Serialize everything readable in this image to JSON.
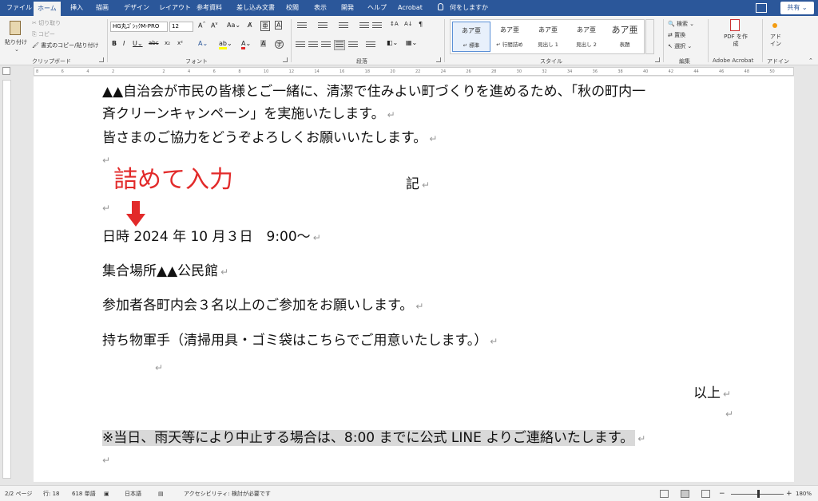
{
  "tabs": [
    {
      "label": "ファイル",
      "active": false
    },
    {
      "label": "ホーム",
      "active": true
    },
    {
      "label": "挿入",
      "active": false
    },
    {
      "label": "描画",
      "active": false
    },
    {
      "label": "デザイン",
      "active": false
    },
    {
      "label": "レイアウト",
      "active": false
    },
    {
      "label": "参考資料",
      "active": false
    },
    {
      "label": "差し込み文書",
      "active": false
    },
    {
      "label": "校閲",
      "active": false
    },
    {
      "label": "表示",
      "active": false
    },
    {
      "label": "開発",
      "active": false
    },
    {
      "label": "ヘルプ",
      "active": false
    },
    {
      "label": "Acrobat",
      "active": false
    }
  ],
  "tellme": "何をしますか",
  "share_label": "共有",
  "ribbon": {
    "clipboard": {
      "paste": "貼り付け",
      "cut": "切り取り",
      "copy": "コピー",
      "format_painter": "書式のコピー/貼り付け",
      "group": "クリップボード"
    },
    "font": {
      "family": "HG丸ｺﾞｼｯｸM-PRO",
      "size": "12",
      "group": "フォント"
    },
    "paragraph": {
      "group": "段落"
    },
    "styles": {
      "items": [
        {
          "preview": "あア亜",
          "name": "↵ 標準",
          "active": true
        },
        {
          "preview": "あア亜",
          "name": "↵ 行間詰め",
          "active": false
        },
        {
          "preview": "あア亜",
          "name": "見出し 1",
          "active": false
        },
        {
          "preview": "あア亜",
          "name": "見出し 2",
          "active": false
        },
        {
          "preview": "あア亜",
          "name": "表題",
          "active": false
        }
      ],
      "group": "スタイル"
    },
    "editing": {
      "find": "検索",
      "replace": "置換",
      "select": "選択",
      "group": "編集"
    },
    "acrobat": {
      "create_pdf": "PDF を作成",
      "group": "Adobe Acrobat"
    },
    "addin": {
      "label": "アド イン",
      "group": "アドイン"
    }
  },
  "ruler_numbers": [
    "8",
    "6",
    "4",
    "2",
    "",
    "2",
    "4",
    "6",
    "8",
    "10",
    "12",
    "14",
    "16",
    "18",
    "20",
    "22",
    "24",
    "26",
    "28",
    "30",
    "32",
    "34",
    "36",
    "38",
    "40",
    "42",
    "44",
    "46",
    "48",
    "50"
  ],
  "document": {
    "line1": "▲▲自治会が市民の皆様とご一緒に、清潔で住みよい町づくりを進めるため、「秋の町内一",
    "line2": "斉クリーンキャンペーン」を実施いたします。",
    "line3": "皆さまのご協力をどうぞよろしくお願いいたします。",
    "ki": "記",
    "datetime": "日時 2024 年 10 月３日　9:00～",
    "place": "集合場所▲▲公民館",
    "participants": "参加者各町内会３名以上のご参加をお願いします。",
    "belongings": "持ち物軍手（清掃用具・ゴミ袋はこちらでご用意いたします。）",
    "ijo": "以上",
    "notice": "※当日、雨天等により中止する場合は、8:00 までに公式 LINE よりご連絡いたします。"
  },
  "annotation": {
    "text": "詰めて入力",
    "color": "#e22a2a"
  },
  "status": {
    "page": "2/2 ページ",
    "line": "行: 18",
    "words": "618 単語",
    "language": "日本語",
    "accessibility": "アクセシビリティ: 検討が必要です",
    "zoom": "180%"
  },
  "colors": {
    "accent": "#2b579a"
  }
}
